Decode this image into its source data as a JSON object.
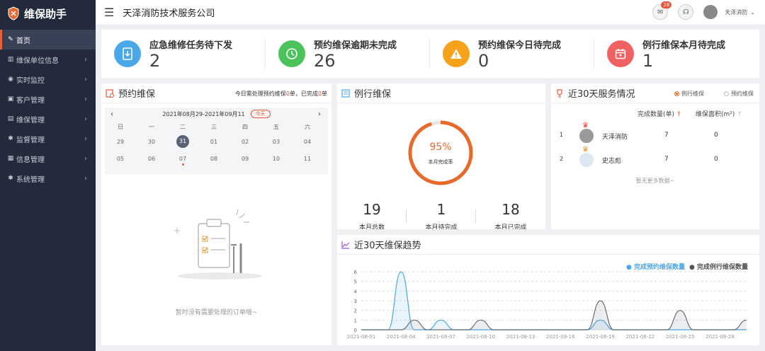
{
  "app": {
    "title": "维保助手"
  },
  "sidebar": {
    "items": [
      {
        "label": "首页",
        "icon": "edit-icon",
        "active": true
      },
      {
        "label": "维保单位信息",
        "icon": "bank-icon"
      },
      {
        "label": "实时监控",
        "icon": "monitor-icon"
      },
      {
        "label": "客户管理",
        "icon": "customer-icon"
      },
      {
        "label": "维保管理",
        "icon": "maintenance-icon"
      },
      {
        "label": "监督管理",
        "icon": "gear-icon"
      },
      {
        "label": "信息管理",
        "icon": "document-icon"
      },
      {
        "label": "系统管理",
        "icon": "gear-icon"
      }
    ]
  },
  "topbar": {
    "company": "天泽消防技术服务公司",
    "mail_badge": "28",
    "username": "天泽消防"
  },
  "stats": [
    {
      "label": "应急维修任务待下发",
      "value": "2",
      "color": "#4aa8ea",
      "icon": "download-doc-icon"
    },
    {
      "label": "预约维保逾期未完成",
      "value": "26",
      "color": "#4cc35a",
      "icon": "clock-icon"
    },
    {
      "label": "预约维保今日待完成",
      "value": "0",
      "color": "#f6a21a",
      "icon": "warning-icon"
    },
    {
      "label": "例行维保本月待完成",
      "value": "1",
      "color": "#f06262",
      "icon": "calendar-icon"
    }
  ],
  "booking": {
    "title": "预约维保",
    "notice_prefix": "今日需处理预约维保",
    "notice_pending": "0",
    "notice_mid": "单，已完成",
    "notice_done": "0",
    "notice_suffix": "单",
    "range": "2021年08月29-2021年09月11",
    "today": "今天",
    "weekdays": [
      "日",
      "一",
      "二",
      "三",
      "四",
      "五",
      "六"
    ],
    "week1": [
      "29",
      "30",
      "31",
      "01",
      "02",
      "03",
      "04"
    ],
    "week2": [
      "05",
      "06",
      "07",
      "08",
      "09",
      "10",
      "11"
    ],
    "empty": "暂时没有需要处理的订单哦~"
  },
  "routine": {
    "title": "例行维保",
    "percent_label": "95%",
    "percent": 0.95,
    "ring_caption": "本月完成率",
    "total": "19",
    "total_label": "本月总数",
    "pending": "1",
    "pending_label": "本月待完成",
    "done": "18",
    "done_label": "本月已完成"
  },
  "service": {
    "title": "近30天服务情况",
    "opt1": "例行维保",
    "opt2": "预约维保",
    "col1": "完成数量(单)",
    "col2": "维保面积(m²)",
    "sort_arrow": "↑",
    "rows": [
      {
        "rank": "1",
        "name": "天泽消防",
        "count": "7",
        "area": "0"
      },
      {
        "rank": "2",
        "name": "史志彪",
        "count": "7",
        "area": "0"
      }
    ],
    "more": "暂无更多数据~"
  },
  "trend": {
    "title": "近30天维保趋势",
    "legend1": "● 完成预约维保数量",
    "legend2": "● 完成例行维保数量"
  },
  "chart_data": {
    "type": "area",
    "x": [
      "2021-08-01",
      "2021-08-02",
      "2021-08-03",
      "2021-08-04",
      "2021-08-05",
      "2021-08-06",
      "2021-08-07",
      "2021-08-08",
      "2021-08-09",
      "2021-08-10",
      "2021-08-11",
      "2021-08-12",
      "2021-08-13",
      "2021-08-14",
      "2021-08-15",
      "2021-08-16",
      "2021-08-17",
      "2021-08-18",
      "2021-08-19",
      "2021-08-20",
      "2021-08-21",
      "2021-08-22",
      "2021-08-23",
      "2021-08-24",
      "2021-08-25",
      "2021-08-26",
      "2021-08-27",
      "2021-08-28",
      "2021-08-29",
      "2021-08-30"
    ],
    "xticks": [
      "2021-08-01",
      "2021-08-04",
      "2021-08-07",
      "2021-08-10",
      "2021-08-13",
      "2021-08-16",
      "2021-08-19",
      "2021-08-22",
      "2021-08-25",
      "2021-08-28"
    ],
    "series": [
      {
        "name": "完成预约维保数量",
        "color": "#4aa8ea",
        "values": [
          0,
          0,
          0,
          6,
          0,
          0,
          1,
          0,
          0,
          0,
          0,
          0,
          0,
          0,
          0,
          0,
          0,
          0,
          1,
          0,
          0,
          0,
          0,
          0,
          0,
          0,
          0,
          0,
          0,
          0
        ]
      },
      {
        "name": "完成例行维保数量",
        "color": "#666e7a",
        "values": [
          0,
          0,
          0,
          0,
          1,
          0,
          0,
          0,
          0,
          1,
          0,
          0,
          0,
          0,
          0,
          0,
          0,
          0,
          3,
          0,
          0,
          0,
          0,
          0,
          2,
          0,
          0,
          0,
          0,
          1
        ]
      }
    ],
    "ylim": [
      0,
      6
    ],
    "yticks": [
      0,
      1,
      2,
      3,
      4,
      5,
      6
    ]
  }
}
